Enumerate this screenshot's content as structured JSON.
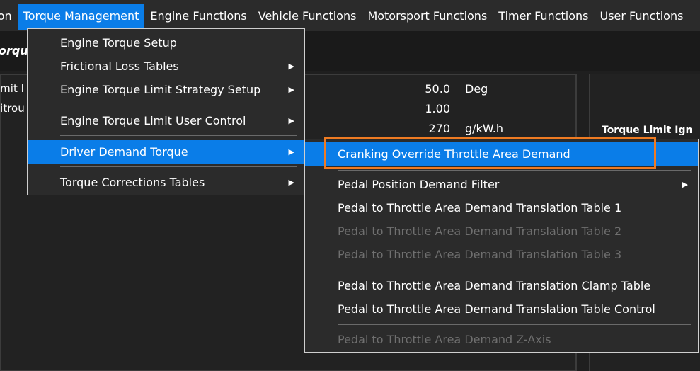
{
  "menubar": {
    "items": [
      "tion",
      "Torque Management",
      "Engine Functions",
      "Vehicle Functions",
      "Motorsport Functions",
      "Timer Functions",
      "User Functions"
    ]
  },
  "toolbar": {
    "title": "orqu"
  },
  "left_panel": {
    "labels": [
      "imit I",
      "litrou"
    ],
    "values": [
      "50.0",
      "1.00",
      "270"
    ],
    "units": [
      "Deg",
      "",
      "g/kW.h"
    ]
  },
  "right_panel": {
    "label": "Torque Limit Ign"
  },
  "menu1": {
    "items": [
      {
        "label": "Engine Torque Setup",
        "arrow": false
      },
      {
        "label": "Frictional Loss Tables",
        "arrow": true
      },
      {
        "label": "Engine Torque Limit Strategy Setup",
        "arrow": true
      },
      {
        "label": "Engine Torque Limit User Control",
        "arrow": true
      },
      {
        "label": "Driver Demand Torque",
        "arrow": true
      },
      {
        "label": "Torque Corrections Tables",
        "arrow": true
      }
    ]
  },
  "menu2": {
    "items": [
      {
        "label": "Cranking Override Throttle Area Demand",
        "state": "active"
      },
      {
        "label": "Pedal Position Demand Filter",
        "state": "enabled",
        "arrow": true
      },
      {
        "label": "Pedal to Throttle Area Demand Translation Table 1",
        "state": "enabled"
      },
      {
        "label": "Pedal to Throttle Area Demand Translation Table 2",
        "state": "disabled"
      },
      {
        "label": "Pedal to Throttle Area Demand Translation Table 3",
        "state": "disabled"
      },
      {
        "label": "Pedal to Throttle Area Demand Translation Clamp Table",
        "state": "enabled"
      },
      {
        "label": "Pedal to Throttle Area Demand Translation Table Control",
        "state": "enabled"
      },
      {
        "label": "Pedal to Throttle Area Demand Z-Axis",
        "state": "disabled"
      }
    ]
  },
  "icons": {
    "submenu_arrow": "chevron-right-icon"
  },
  "colors": {
    "accent": "#0a7de8",
    "highlight_outline": "#ef7b22",
    "menu_bg": "#2b2b2b",
    "disabled_text": "#6f6f6f"
  }
}
